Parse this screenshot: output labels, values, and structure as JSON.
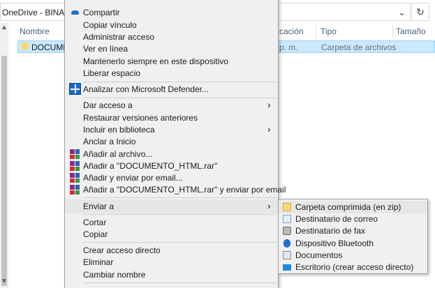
{
  "explorer": {
    "address": "OneDrive - BINAPS CO",
    "columns": {
      "name": "Nombre",
      "date": "cación",
      "type": "Tipo",
      "size": "Tamaño"
    },
    "row": {
      "name": "DOCUMEN",
      "date": "p. m.",
      "type": "Carpeta de archivos"
    },
    "icons": {
      "chevron": "⌄",
      "refresh": "↻",
      "scroll_up": "▲",
      "scroll_down": "▼"
    }
  },
  "context_menu": {
    "items": [
      {
        "label": "Compartir",
        "icon": "onedrive-icon"
      },
      {
        "label": "Copiar vínculo"
      },
      {
        "label": "Administrar acceso"
      },
      {
        "label": "Ver en línea"
      },
      {
        "label": "Mantenerlo siempre en este dispositivo"
      },
      {
        "label": "Liberar espacio"
      },
      {
        "label": "Analizar con Microsoft Defender...",
        "icon": "defender-icon"
      },
      {
        "label": "Dar acceso a",
        "submenu": true
      },
      {
        "label": "Restaurar versiones anteriores"
      },
      {
        "label": "Incluir en biblioteca",
        "submenu": true
      },
      {
        "label": "Anclar a Inicio"
      },
      {
        "label": "Añadir al archivo...",
        "icon": "winrar-icon"
      },
      {
        "label": "Añadir a \"DOCUMENTO_HTML.rar\"",
        "icon": "winrar-icon"
      },
      {
        "label": "Añadir y enviar por email...",
        "icon": "winrar-icon"
      },
      {
        "label": "Añadir a \"DOCUMENTO_HTML.rar\" y enviar por email",
        "icon": "winrar-icon"
      },
      {
        "label": "Enviar a",
        "submenu": true,
        "highlighted": true
      },
      {
        "label": "Cortar"
      },
      {
        "label": "Copiar"
      },
      {
        "label": "Crear acceso directo"
      },
      {
        "label": "Eliminar"
      },
      {
        "label": "Cambiar nombre"
      }
    ],
    "arrow": "›"
  },
  "send_to_menu": {
    "items": [
      {
        "label": "Carpeta comprimida (en zip)",
        "icon": "zip-folder-icon",
        "highlighted": true
      },
      {
        "label": "Destinatario de correo",
        "icon": "mail-icon"
      },
      {
        "label": "Destinatario de fax",
        "icon": "fax-icon"
      },
      {
        "label": "Dispositivo Bluetooth",
        "icon": "bluetooth-icon"
      },
      {
        "label": "Documentos",
        "icon": "documents-icon"
      },
      {
        "label": "Escritorio (crear acceso directo)",
        "icon": "desktop-icon"
      }
    ]
  },
  "colors": {
    "selection": "#cce8ff",
    "menu_bg": "#f0f0f0",
    "accent": "#1a6ac4"
  }
}
